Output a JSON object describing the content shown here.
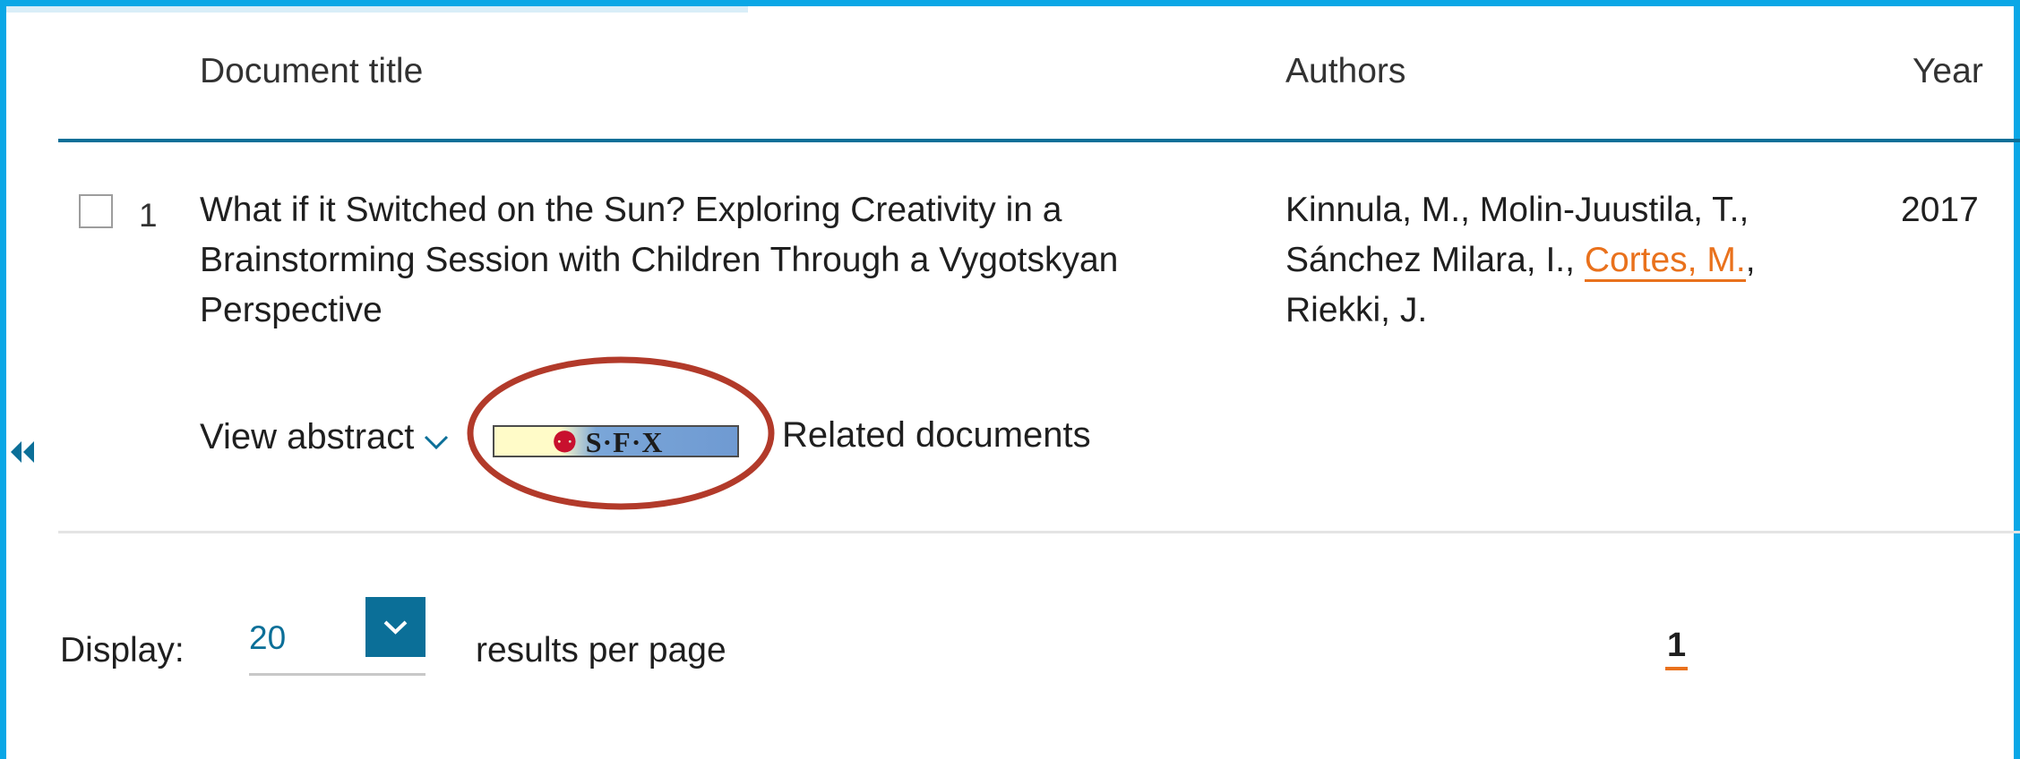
{
  "table": {
    "headers": {
      "document_title": "Document title",
      "authors": "Authors",
      "year": "Year"
    },
    "rows": [
      {
        "number": "1",
        "title": "What if it Switched on the Sun? Exploring Creativity in a Brainstorming Session with Children Through a Vygotskyan Perspective",
        "authors_plain_before": "Kinnula, M., Molin-Juustila, T., Sánchez Milara, I., ",
        "author_link": "Cortes, M.",
        "authors_plain_after": ", Riekki, J.",
        "year": "2017",
        "actions": {
          "view_abstract": "View abstract",
          "sfx_label": "S·F·X",
          "related_documents": "Related documents"
        }
      }
    ]
  },
  "pagination": {
    "display_label": "Display:",
    "per_page_value": "20",
    "results_label": "results per page",
    "current_page": "1"
  },
  "colors": {
    "frame": "#0aa7e6",
    "accent": "#0b6f98",
    "link": "#e9711c",
    "highlight": "#b23a2a"
  },
  "icons": {
    "collapse": "double-chevron-left-icon",
    "abstract_toggle": "chevron-down-icon",
    "select": "chevron-down-icon",
    "sfx": "sfx-logo-icon"
  }
}
